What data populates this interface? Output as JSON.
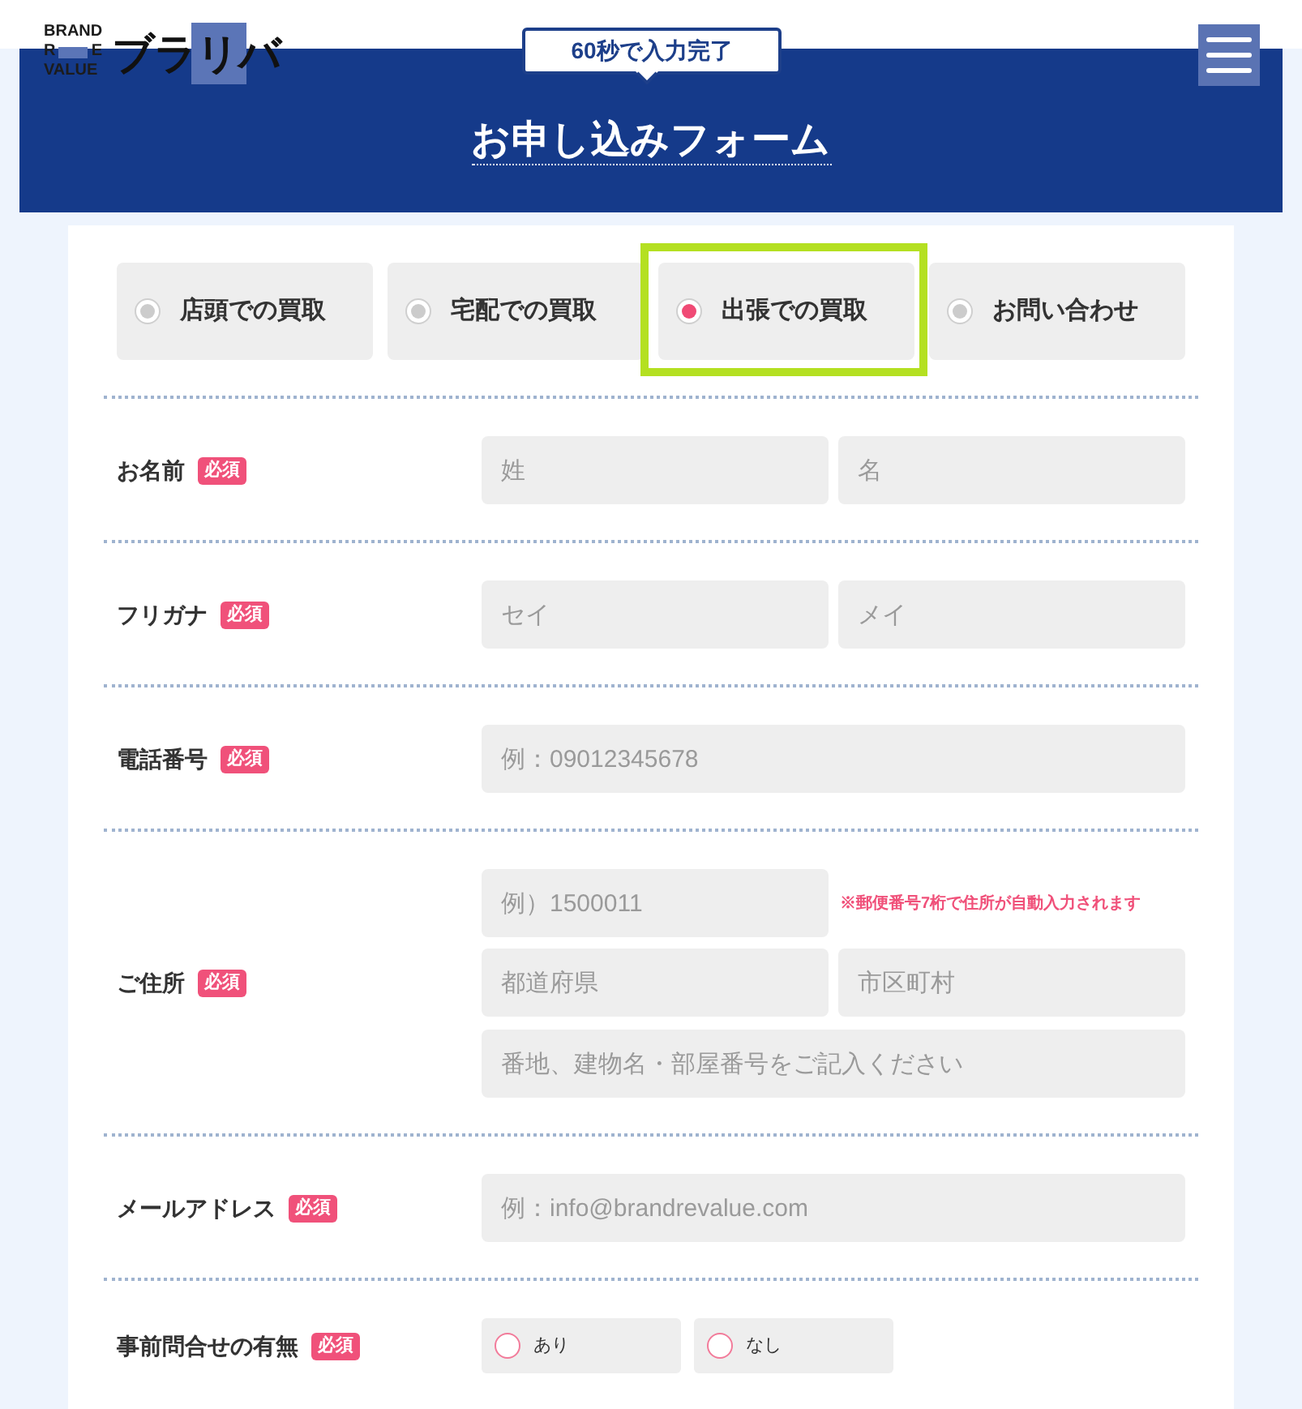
{
  "header": {
    "logo": {
      "lines": [
        "BRAND",
        "R",
        "E",
        "VALUE"
      ],
      "wordmark": "ブラリバ"
    },
    "bubble": "60秒で入力完了",
    "title": "お申し込みフォーム"
  },
  "tabs": [
    {
      "label": "店頭での買取",
      "selected": false,
      "highlighted": false
    },
    {
      "label": "宅配での買取",
      "selected": false,
      "highlighted": false
    },
    {
      "label": "出張での買取",
      "selected": true,
      "highlighted": true
    },
    {
      "label": "お問い合わせ",
      "selected": false,
      "highlighted": false
    }
  ],
  "fields": [
    {
      "kind": "pair",
      "label": "お名前",
      "badge": "必須",
      "inputs": [
        {
          "placeholder": "姓"
        },
        {
          "placeholder": "名"
        }
      ]
    },
    {
      "kind": "pair",
      "label": "フリガナ",
      "badge": "必須",
      "inputs": [
        {
          "placeholder": "セイ"
        },
        {
          "placeholder": "メイ"
        }
      ]
    },
    {
      "kind": "single",
      "label": "電話番号",
      "badge": "必須",
      "inputs": [
        {
          "placeholder": "例：09012345678"
        }
      ]
    },
    {
      "kind": "address",
      "label": "ご住所",
      "badge": "必須",
      "inputs": [
        {
          "placeholder": "例）1500011",
          "note": "※郵便番号7桁で住所が自動入力されます"
        },
        {
          "placeholder": "都道府県"
        },
        {
          "placeholder": "市区町村"
        },
        {
          "placeholder": "番地、建物名・部屋番号をご記入ください"
        }
      ]
    },
    {
      "kind": "single",
      "label": "メールアドレス",
      "badge": "必須",
      "inputs": [
        {
          "placeholder": "例：info@brandrevalue.com"
        }
      ]
    },
    {
      "kind": "radio",
      "label": "事前問合せの有無",
      "badge": "必須",
      "options": [
        {
          "label": "あり",
          "selected": false
        },
        {
          "label": "なし",
          "selected": false
        }
      ]
    }
  ]
}
